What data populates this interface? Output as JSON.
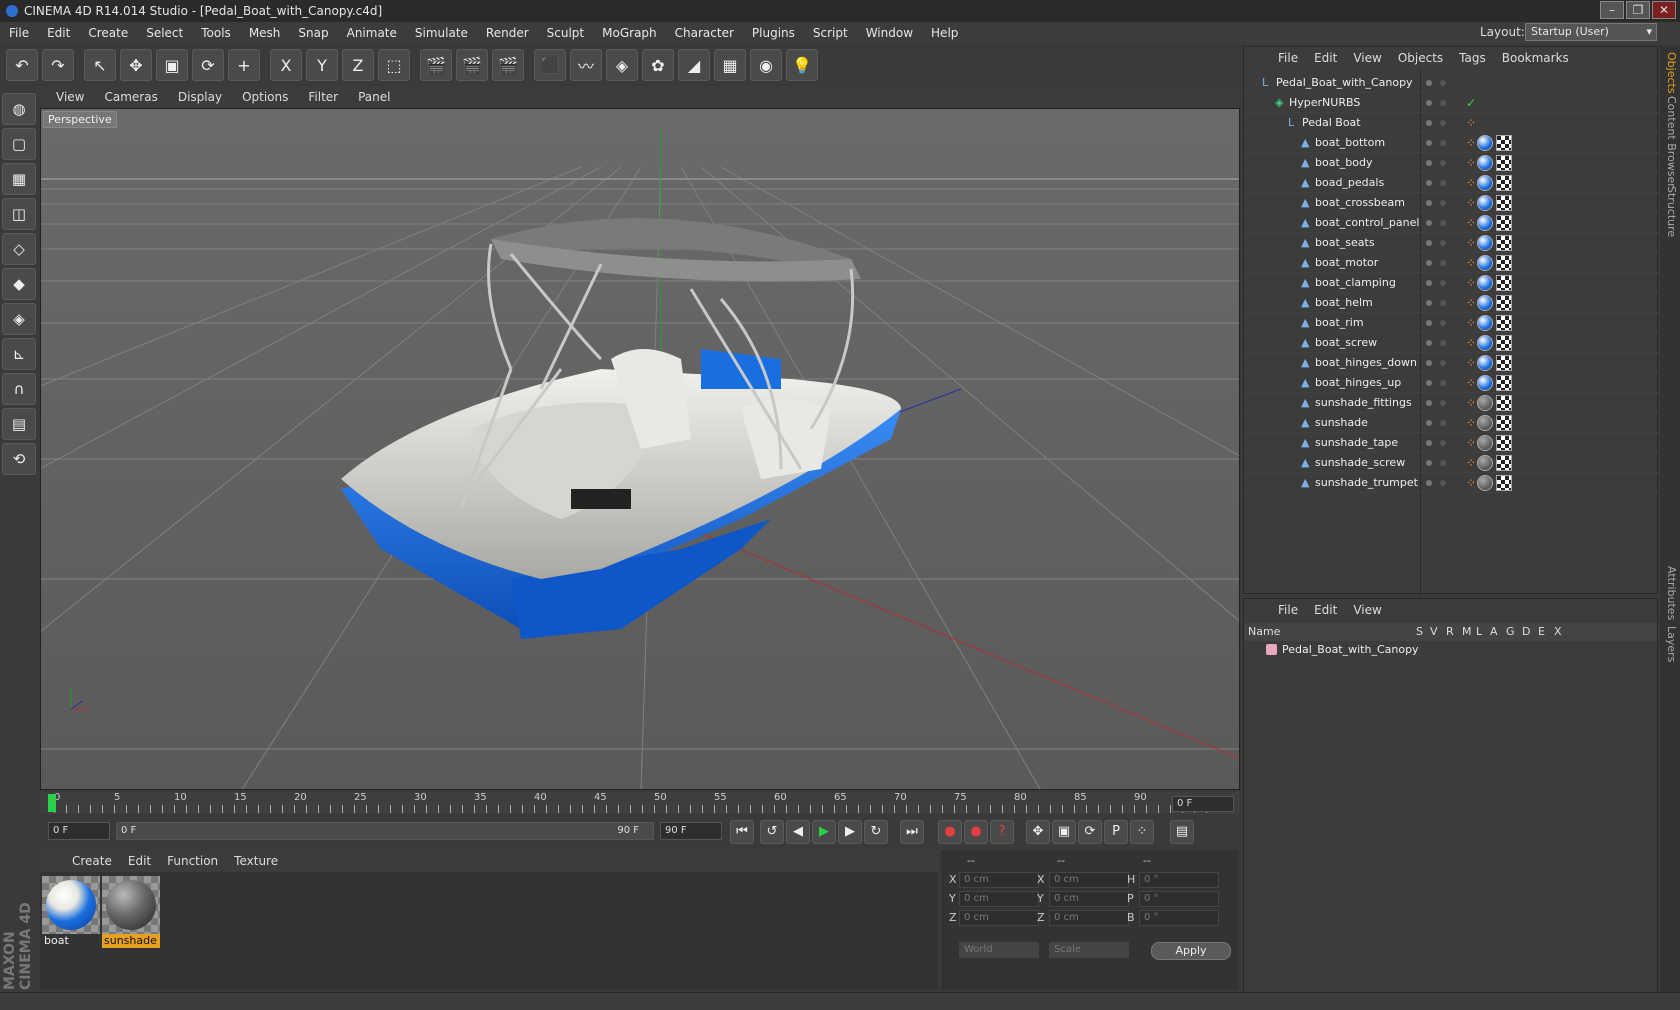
{
  "window": {
    "title": "CINEMA 4D R14.014 Studio - [Pedal_Boat_with_Canopy.c4d]",
    "controls": [
      "–",
      "❐",
      "✕"
    ]
  },
  "menu": [
    "File",
    "Edit",
    "Create",
    "Select",
    "Tools",
    "Mesh",
    "Snap",
    "Animate",
    "Simulate",
    "Render",
    "Sculpt",
    "MoGraph",
    "Character",
    "Plugins",
    "Script",
    "Window",
    "Help"
  ],
  "layout": {
    "label": "Layout:",
    "value": "Startup (User)"
  },
  "toolbar": {
    "icons": [
      "undo-icon",
      "redo-icon",
      "live-select-icon",
      "move-icon",
      "scale-icon",
      "rotate-icon",
      "add-icon",
      "x-axis-icon",
      "y-axis-icon",
      "z-axis-icon",
      "coord-system-icon",
      "render-view-icon",
      "render-region-icon",
      "render-settings-icon",
      "cube-icon",
      "spline-icon",
      "nurbs-icon",
      "array-icon",
      "deformer-icon",
      "floor-icon",
      "camera-icon",
      "light-icon"
    ],
    "glyphs": [
      "↶",
      "↷",
      "↖",
      "✥",
      "▣",
      "⟳",
      "+",
      "X",
      "Y",
      "Z",
      "⬚",
      "🎬",
      "🎬",
      "🎬",
      "⬛",
      "〰",
      "◈",
      "✿",
      "◢",
      "▦",
      "◉",
      "💡"
    ]
  },
  "left_tools": {
    "glyphs": [
      "◍",
      "▢",
      "▦",
      "◫",
      "◇",
      "◆",
      "◈",
      "⊾",
      "∩",
      "▤",
      "⟲"
    ],
    "icons": [
      "make-editable-icon",
      "model-mode-icon",
      "texture-mode-icon",
      "workplane-icon",
      "points-mode-icon",
      "edges-mode-icon",
      "polygons-mode-icon",
      "axis-icon",
      "snap-magnet-icon",
      "grid-icon",
      "lock-icon"
    ]
  },
  "brand": "MAXON CINEMA 4D",
  "viewport": {
    "menu": [
      "View",
      "Cameras",
      "Display",
      "Options",
      "Filter",
      "Panel"
    ],
    "label": "Perspective"
  },
  "timeline": {
    "ticks": [
      "0",
      "5",
      "10",
      "15",
      "20",
      "25",
      "30",
      "35",
      "40",
      "45",
      "50",
      "55",
      "60",
      "65",
      "70",
      "75",
      "80",
      "85",
      "90"
    ],
    "current": "0 F"
  },
  "transport": {
    "start": "0 F",
    "range_start": "0 F",
    "range_end": "90 F",
    "end": "90 F",
    "glyphs": [
      "⏮",
      "↺",
      "◀",
      "▶",
      "▶",
      "↻",
      "⏭",
      "●",
      "●",
      "?",
      "✥",
      "▣",
      "⟳",
      "P",
      "⁘",
      "▤"
    ]
  },
  "materials": {
    "menu": [
      "Create",
      "Edit",
      "Function",
      "Texture"
    ],
    "items": [
      {
        "name": "boat"
      },
      {
        "name": "sunshade"
      }
    ]
  },
  "coords": {
    "headers": [
      "--",
      "--",
      "--"
    ],
    "rows": [
      {
        "a": "X",
        "av": "0 cm",
        "b": "X",
        "bv": "0 cm",
        "c": "H",
        "cv": "0 °"
      },
      {
        "a": "Y",
        "av": "0 cm",
        "b": "Y",
        "bv": "0 cm",
        "c": "P",
        "cv": "0 °"
      },
      {
        "a": "Z",
        "av": "0 cm",
        "b": "Z",
        "bv": "0 cm",
        "c": "B",
        "cv": "0 °"
      }
    ],
    "mode1": "World",
    "mode2": "Scale",
    "apply": "Apply"
  },
  "objects": {
    "menu": [
      "File",
      "Edit",
      "View",
      "Objects",
      "Tags",
      "Bookmarks"
    ],
    "rows": [
      {
        "name": "Pedal_Boat_with_Canopy",
        "level": 0,
        "kind": "null"
      },
      {
        "name": "HyperNURBS",
        "level": 1,
        "kind": "nurbs"
      },
      {
        "name": "Pedal Boat",
        "level": 2,
        "kind": "null"
      },
      {
        "name": "boat_bottom",
        "level": 3,
        "kind": "poly",
        "mat": "boat"
      },
      {
        "name": "boat_body",
        "level": 3,
        "kind": "poly",
        "mat": "boat"
      },
      {
        "name": "boad_pedals",
        "level": 3,
        "kind": "poly",
        "mat": "boat"
      },
      {
        "name": "boat_crossbeam",
        "level": 3,
        "kind": "poly",
        "mat": "boat"
      },
      {
        "name": "boat_control_panel",
        "level": 3,
        "kind": "poly",
        "mat": "boat"
      },
      {
        "name": "boat_seats",
        "level": 3,
        "kind": "poly",
        "mat": "boat"
      },
      {
        "name": "boat_motor",
        "level": 3,
        "kind": "poly",
        "mat": "boat"
      },
      {
        "name": "boat_clamping",
        "level": 3,
        "kind": "poly",
        "mat": "boat"
      },
      {
        "name": "boat_helm",
        "level": 3,
        "kind": "poly",
        "mat": "boat"
      },
      {
        "name": "boat_rim",
        "level": 3,
        "kind": "poly",
        "mat": "boat"
      },
      {
        "name": "boat_screw",
        "level": 3,
        "kind": "poly",
        "mat": "boat"
      },
      {
        "name": "boat_hinges_down",
        "level": 3,
        "kind": "poly",
        "mat": "boat"
      },
      {
        "name": "boat_hinges_up",
        "level": 3,
        "kind": "poly",
        "mat": "boat"
      },
      {
        "name": "sunshade_fittings",
        "level": 3,
        "kind": "poly",
        "mat": "sunshade"
      },
      {
        "name": "sunshade",
        "level": 3,
        "kind": "poly",
        "mat": "sunshade"
      },
      {
        "name": "sunshade_tape",
        "level": 3,
        "kind": "poly",
        "mat": "sunshade"
      },
      {
        "name": "sunshade_screw",
        "level": 3,
        "kind": "poly",
        "mat": "sunshade"
      },
      {
        "name": "sunshade_trumpet",
        "level": 3,
        "kind": "poly",
        "mat": "sunshade"
      }
    ]
  },
  "layers": {
    "menu": [
      "File",
      "Edit",
      "View"
    ],
    "headers": [
      "Name",
      "S",
      "V",
      "R",
      "M",
      "L",
      "A",
      "G",
      "D",
      "E",
      "X"
    ],
    "row": "Pedal_Boat_with_Canopy"
  },
  "side_tabs": [
    "Objects",
    "Content Browser",
    "Structure",
    "Attributes",
    "Layers"
  ],
  "colors": {
    "boat_blue": "#1a6fe0",
    "accent_orange": "#ff9a30",
    "layer_pink": "#e8a8c0"
  }
}
